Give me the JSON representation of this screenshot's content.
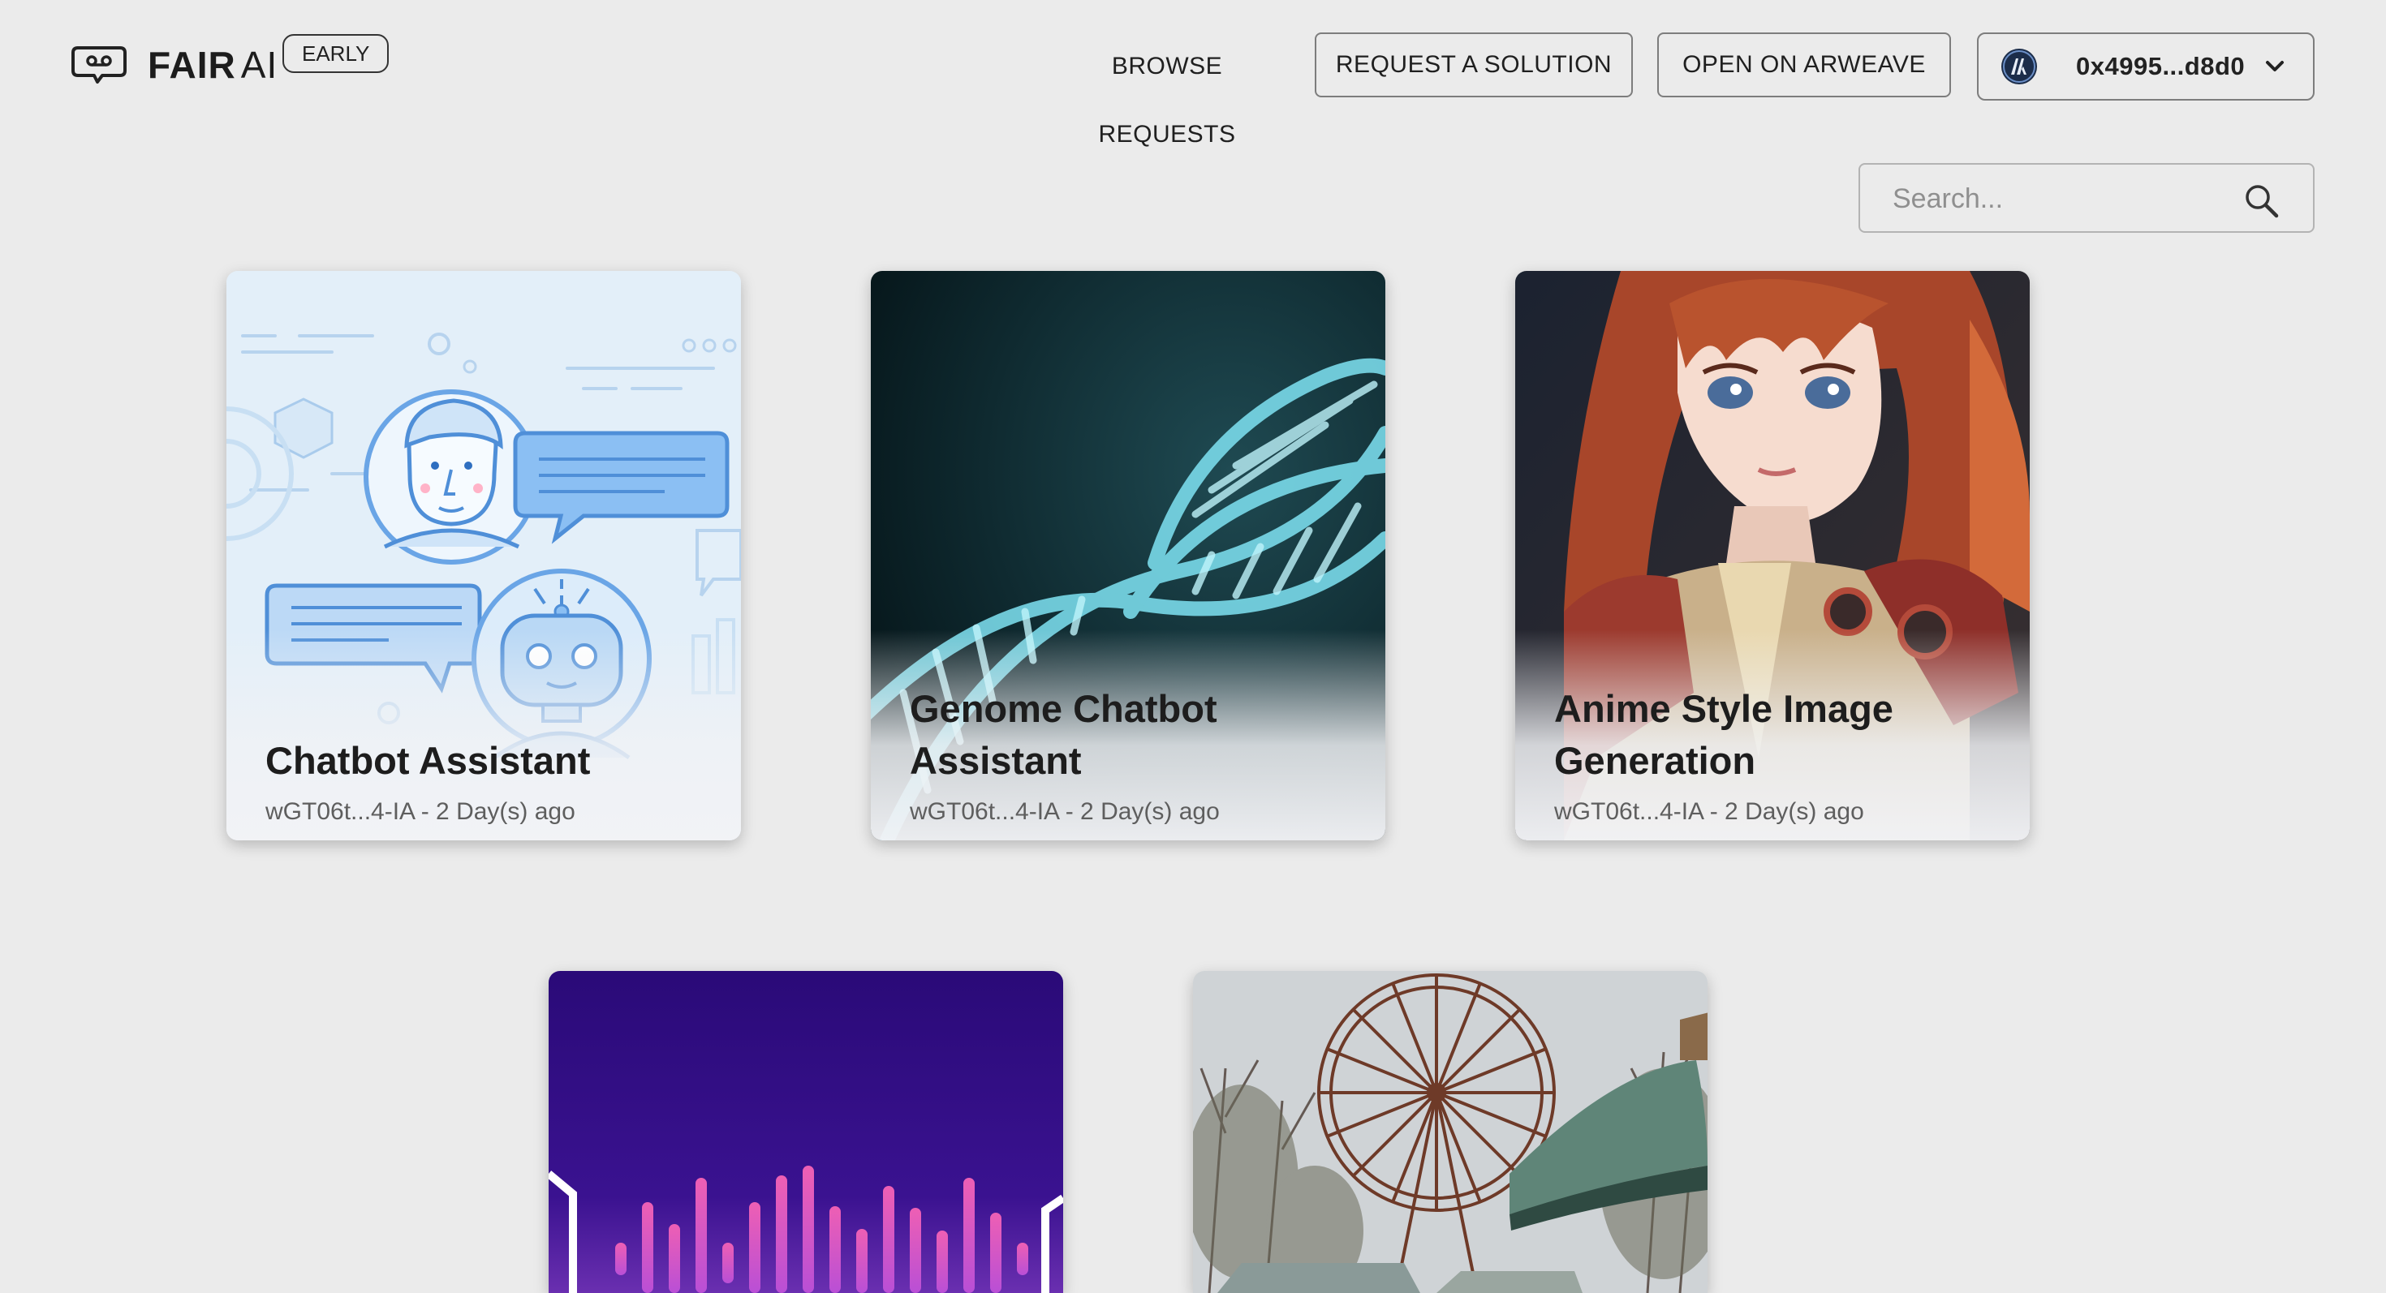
{
  "header": {
    "brand_strong": "FAIR",
    "brand_light": "AI",
    "badge": "EARLY",
    "nav": {
      "browse": "BROWSE REQUESTS",
      "request": "REQUEST A SOLUTION",
      "arweave": "OPEN ON ARWEAVE"
    },
    "wallet": {
      "address": "0x4995...d8d0",
      "avatar_icon": "arweave-icon",
      "chevron_icon": "chevron-down-icon"
    }
  },
  "search": {
    "placeholder": "Search...",
    "icon": "search-icon"
  },
  "cards": [
    {
      "title": "Chatbot Assistant",
      "meta": "wGT06t...4-IA - 2 Day(s) ago"
    },
    {
      "title": "Genome Chatbot Assistant",
      "meta": "wGT06t...4-IA - 2 Day(s) ago"
    },
    {
      "title": "Anime Style Image Generation",
      "meta": "wGT06t...4-IA - 2 Day(s) ago"
    },
    {
      "title": "",
      "meta": ""
    },
    {
      "title": "",
      "meta": ""
    }
  ],
  "colors": {
    "page_bg": "#ebebeb",
    "text": "#1f1f1f",
    "chatbot_bg": "#e3eff9",
    "chatbot_accent": "#7fb5f0",
    "genome_bg": "#0f2a30",
    "genome_helix": "#6fd6e8",
    "audio_bg": "#2a0a78",
    "audio_bars": "#ee5fb4"
  }
}
